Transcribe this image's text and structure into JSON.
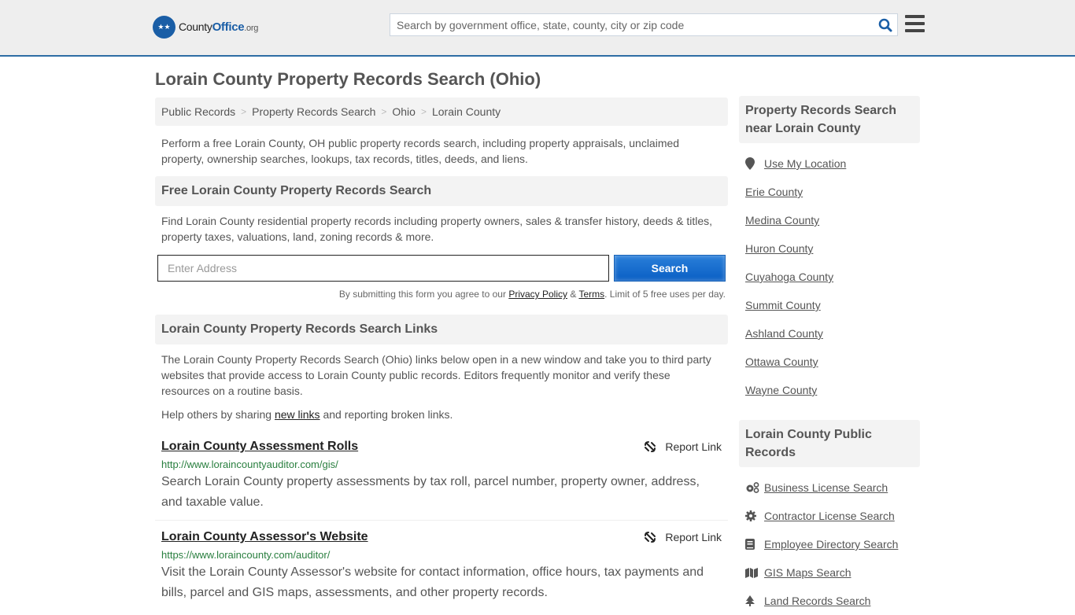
{
  "header": {
    "logo_county": "County",
    "logo_office": "Office",
    "logo_org": ".org",
    "search_placeholder": "Search by government office, state, county, city or zip code"
  },
  "page_title": "Lorain County Property Records Search (Ohio)",
  "breadcrumb": [
    "Public Records",
    "Property Records Search",
    "Ohio",
    "Lorain County"
  ],
  "intro": "Perform a free Lorain County, OH public property records search, including property appraisals, unclaimed property, ownership searches, lookups, tax records, titles, deeds, and liens.",
  "free_search": {
    "heading": "Free Lorain County Property Records Search",
    "description": "Find Lorain County residential property records including property owners, sales & transfer history, deeds & titles, property taxes, valuations, land, zoning records & more.",
    "address_placeholder": "Enter Address",
    "search_label": "Search",
    "terms_prefix": "By submitting this form you agree to our ",
    "privacy_label": "Privacy Policy",
    "terms_amp": " & ",
    "terms_label": "Terms",
    "terms_suffix": ". Limit of 5 free uses per day."
  },
  "links_section": {
    "heading": "Lorain County Property Records Search Links",
    "description": "The Lorain County Property Records Search (Ohio) links below open in a new window and take you to third party websites that provide access to Lorain County public records. Editors frequently monitor and verify these resources on a routine basis.",
    "help_prefix": "Help others by sharing ",
    "help_link": "new links",
    "help_suffix": " and reporting broken links.",
    "report_label": "Report Link",
    "items": [
      {
        "title": "Lorain County Assessment Rolls",
        "url": "http://www.loraincountyauditor.com/gis/",
        "description": "Search Lorain County property assessments by tax roll, parcel number, property owner, address, and taxable value."
      },
      {
        "title": "Lorain County Assessor's Website",
        "url": "https://www.loraincounty.com/auditor/",
        "description": "Visit the Lorain County Assessor's website for contact information, office hours, tax payments and bills, parcel and GIS maps, assessments, and other property records."
      }
    ]
  },
  "sidebar": {
    "nearby_heading": "Property Records Search near Lorain County",
    "use_location": "Use My Location",
    "nearby": [
      "Erie County",
      "Medina County",
      "Huron County",
      "Cuyahoga County",
      "Summit County",
      "Ashland County",
      "Ottawa County",
      "Wayne County"
    ],
    "public_heading": "Lorain County Public Records",
    "public_records": [
      {
        "label": "Business License Search",
        "icon": "cogs-icon"
      },
      {
        "label": "Contractor License Search",
        "icon": "gear-icon"
      },
      {
        "label": "Employee Directory Search",
        "icon": "book-icon"
      },
      {
        "label": "GIS Maps Search",
        "icon": "map-icon"
      },
      {
        "label": "Land Records Search",
        "icon": "tree-icon"
      }
    ]
  },
  "colors": {
    "brand": "#1a5ea6",
    "url_green": "#297f3f",
    "button_blue": "#0a5fc4"
  }
}
